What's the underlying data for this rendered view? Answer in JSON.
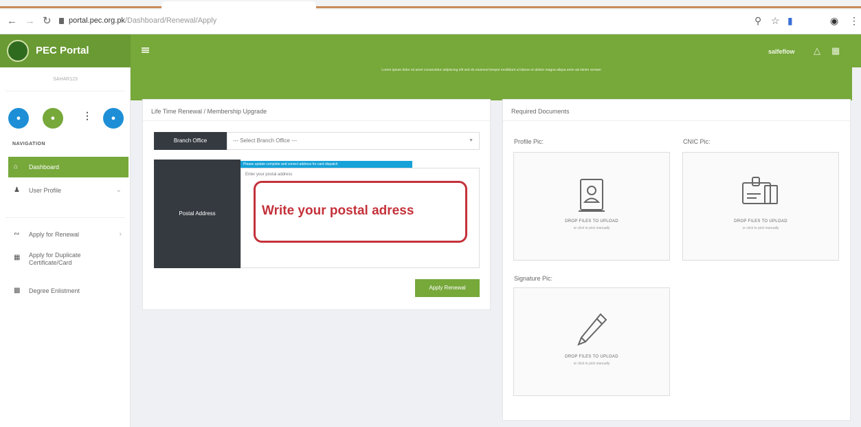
{
  "browser": {
    "back_icon": "arrow-left-icon",
    "forward_icon": "arrow-right-icon",
    "reload_icon": "reload-icon",
    "url_host": "portal.pec.org.pk",
    "url_path": "/Dashboard/Renewal/Apply"
  },
  "header": {
    "brand_title": "PEC Portal",
    "user_name": "salfeflow",
    "banner_text": "Lorem ipsum dolor sit amet consectetur adipiscing elit sed do eiusmod tempor incididunt ut labore et dolore magna aliqua enim ad minim veniam"
  },
  "sidebar": {
    "username": "SAHAR123",
    "nav_heading": "NAVIGATION",
    "items": [
      {
        "label": "Dashboard",
        "icon": "home-icon"
      },
      {
        "label": "User Profile",
        "icon": "user-icon"
      },
      {
        "label": "Apply for Renewal",
        "icon": "link-icon"
      },
      {
        "label": "Apply for Duplicate Certificate/Card",
        "icon": "document-icon"
      },
      {
        "label": "Degree Enlistment",
        "icon": "grid-icon"
      }
    ]
  },
  "renewal_panel": {
    "title": "Life Time Renewal / Membership Upgrade",
    "branch_label": "Branch Office",
    "branch_select": "--- Select Branch Office ---",
    "postal_label": "Postal Address",
    "postal_hint": "Please update complete and correct address for card dispatch",
    "postal_placeholder": "Enter your postal address",
    "callout_text": "Write your postal adress",
    "apply_button": "Apply Renewal"
  },
  "documents_panel": {
    "title": "Required Documents",
    "profile_label": "Profile Pic:",
    "cnic_label": "CNIC Pic:",
    "signature_label": "Signature Pic:",
    "drop_title": "DROP FILES TO UPLOAD",
    "drop_sub": "or click to pick manually"
  },
  "colors": {
    "brand_green": "#76a83a",
    "dark_label": "#343a40",
    "callout_red": "#c4313a",
    "hint_blue": "#17a2d8"
  }
}
